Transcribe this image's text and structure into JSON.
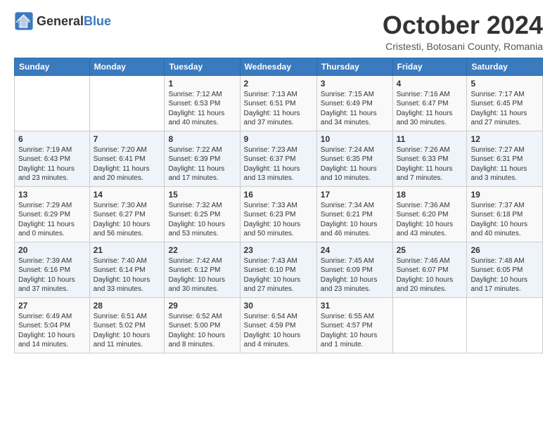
{
  "logo": {
    "text_general": "General",
    "text_blue": "Blue"
  },
  "header": {
    "month_title": "October 2024",
    "subtitle": "Cristesti, Botosani County, Romania"
  },
  "days_of_week": [
    "Sunday",
    "Monday",
    "Tuesday",
    "Wednesday",
    "Thursday",
    "Friday",
    "Saturday"
  ],
  "weeks": [
    [
      {
        "day": "",
        "text": ""
      },
      {
        "day": "",
        "text": ""
      },
      {
        "day": "1",
        "text": "Sunrise: 7:12 AM\nSunset: 6:53 PM\nDaylight: 11 hours and 40 minutes."
      },
      {
        "day": "2",
        "text": "Sunrise: 7:13 AM\nSunset: 6:51 PM\nDaylight: 11 hours and 37 minutes."
      },
      {
        "day": "3",
        "text": "Sunrise: 7:15 AM\nSunset: 6:49 PM\nDaylight: 11 hours and 34 minutes."
      },
      {
        "day": "4",
        "text": "Sunrise: 7:16 AM\nSunset: 6:47 PM\nDaylight: 11 hours and 30 minutes."
      },
      {
        "day": "5",
        "text": "Sunrise: 7:17 AM\nSunset: 6:45 PM\nDaylight: 11 hours and 27 minutes."
      }
    ],
    [
      {
        "day": "6",
        "text": "Sunrise: 7:19 AM\nSunset: 6:43 PM\nDaylight: 11 hours and 23 minutes."
      },
      {
        "day": "7",
        "text": "Sunrise: 7:20 AM\nSunset: 6:41 PM\nDaylight: 11 hours and 20 minutes."
      },
      {
        "day": "8",
        "text": "Sunrise: 7:22 AM\nSunset: 6:39 PM\nDaylight: 11 hours and 17 minutes."
      },
      {
        "day": "9",
        "text": "Sunrise: 7:23 AM\nSunset: 6:37 PM\nDaylight: 11 hours and 13 minutes."
      },
      {
        "day": "10",
        "text": "Sunrise: 7:24 AM\nSunset: 6:35 PM\nDaylight: 11 hours and 10 minutes."
      },
      {
        "day": "11",
        "text": "Sunrise: 7:26 AM\nSunset: 6:33 PM\nDaylight: 11 hours and 7 minutes."
      },
      {
        "day": "12",
        "text": "Sunrise: 7:27 AM\nSunset: 6:31 PM\nDaylight: 11 hours and 3 minutes."
      }
    ],
    [
      {
        "day": "13",
        "text": "Sunrise: 7:29 AM\nSunset: 6:29 PM\nDaylight: 11 hours and 0 minutes."
      },
      {
        "day": "14",
        "text": "Sunrise: 7:30 AM\nSunset: 6:27 PM\nDaylight: 10 hours and 56 minutes."
      },
      {
        "day": "15",
        "text": "Sunrise: 7:32 AM\nSunset: 6:25 PM\nDaylight: 10 hours and 53 minutes."
      },
      {
        "day": "16",
        "text": "Sunrise: 7:33 AM\nSunset: 6:23 PM\nDaylight: 10 hours and 50 minutes."
      },
      {
        "day": "17",
        "text": "Sunrise: 7:34 AM\nSunset: 6:21 PM\nDaylight: 10 hours and 46 minutes."
      },
      {
        "day": "18",
        "text": "Sunrise: 7:36 AM\nSunset: 6:20 PM\nDaylight: 10 hours and 43 minutes."
      },
      {
        "day": "19",
        "text": "Sunrise: 7:37 AM\nSunset: 6:18 PM\nDaylight: 10 hours and 40 minutes."
      }
    ],
    [
      {
        "day": "20",
        "text": "Sunrise: 7:39 AM\nSunset: 6:16 PM\nDaylight: 10 hours and 37 minutes."
      },
      {
        "day": "21",
        "text": "Sunrise: 7:40 AM\nSunset: 6:14 PM\nDaylight: 10 hours and 33 minutes."
      },
      {
        "day": "22",
        "text": "Sunrise: 7:42 AM\nSunset: 6:12 PM\nDaylight: 10 hours and 30 minutes."
      },
      {
        "day": "23",
        "text": "Sunrise: 7:43 AM\nSunset: 6:10 PM\nDaylight: 10 hours and 27 minutes."
      },
      {
        "day": "24",
        "text": "Sunrise: 7:45 AM\nSunset: 6:09 PM\nDaylight: 10 hours and 23 minutes."
      },
      {
        "day": "25",
        "text": "Sunrise: 7:46 AM\nSunset: 6:07 PM\nDaylight: 10 hours and 20 minutes."
      },
      {
        "day": "26",
        "text": "Sunrise: 7:48 AM\nSunset: 6:05 PM\nDaylight: 10 hours and 17 minutes."
      }
    ],
    [
      {
        "day": "27",
        "text": "Sunrise: 6:49 AM\nSunset: 5:04 PM\nDaylight: 10 hours and 14 minutes."
      },
      {
        "day": "28",
        "text": "Sunrise: 6:51 AM\nSunset: 5:02 PM\nDaylight: 10 hours and 11 minutes."
      },
      {
        "day": "29",
        "text": "Sunrise: 6:52 AM\nSunset: 5:00 PM\nDaylight: 10 hours and 8 minutes."
      },
      {
        "day": "30",
        "text": "Sunrise: 6:54 AM\nSunset: 4:59 PM\nDaylight: 10 hours and 4 minutes."
      },
      {
        "day": "31",
        "text": "Sunrise: 6:55 AM\nSunset: 4:57 PM\nDaylight: 10 hours and 1 minute."
      },
      {
        "day": "",
        "text": ""
      },
      {
        "day": "",
        "text": ""
      }
    ]
  ]
}
